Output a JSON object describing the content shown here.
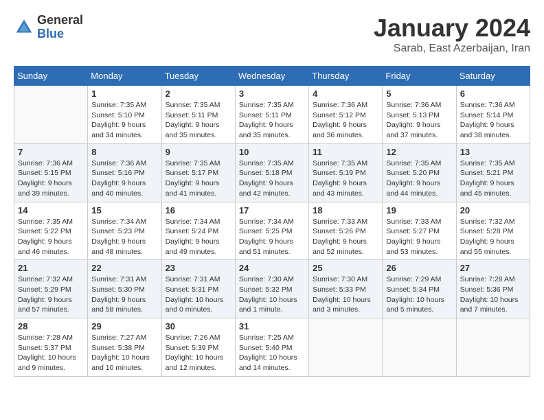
{
  "header": {
    "logo_general": "General",
    "logo_blue": "Blue",
    "month_title": "January 2024",
    "location": "Sarab, East Azerbaijan, Iran"
  },
  "columns": [
    "Sunday",
    "Monday",
    "Tuesday",
    "Wednesday",
    "Thursday",
    "Friday",
    "Saturday"
  ],
  "weeks": [
    [
      {
        "day": "",
        "sunrise": "",
        "sunset": "",
        "daylight": ""
      },
      {
        "day": "1",
        "sunrise": "Sunrise: 7:35 AM",
        "sunset": "Sunset: 5:10 PM",
        "daylight": "Daylight: 9 hours and 34 minutes."
      },
      {
        "day": "2",
        "sunrise": "Sunrise: 7:35 AM",
        "sunset": "Sunset: 5:11 PM",
        "daylight": "Daylight: 9 hours and 35 minutes."
      },
      {
        "day": "3",
        "sunrise": "Sunrise: 7:35 AM",
        "sunset": "Sunset: 5:11 PM",
        "daylight": "Daylight: 9 hours and 35 minutes."
      },
      {
        "day": "4",
        "sunrise": "Sunrise: 7:36 AM",
        "sunset": "Sunset: 5:12 PM",
        "daylight": "Daylight: 9 hours and 36 minutes."
      },
      {
        "day": "5",
        "sunrise": "Sunrise: 7:36 AM",
        "sunset": "Sunset: 5:13 PM",
        "daylight": "Daylight: 9 hours and 37 minutes."
      },
      {
        "day": "6",
        "sunrise": "Sunrise: 7:36 AM",
        "sunset": "Sunset: 5:14 PM",
        "daylight": "Daylight: 9 hours and 38 minutes."
      }
    ],
    [
      {
        "day": "7",
        "sunrise": "Sunrise: 7:36 AM",
        "sunset": "Sunset: 5:15 PM",
        "daylight": "Daylight: 9 hours and 39 minutes."
      },
      {
        "day": "8",
        "sunrise": "Sunrise: 7:36 AM",
        "sunset": "Sunset: 5:16 PM",
        "daylight": "Daylight: 9 hours and 40 minutes."
      },
      {
        "day": "9",
        "sunrise": "Sunrise: 7:35 AM",
        "sunset": "Sunset: 5:17 PM",
        "daylight": "Daylight: 9 hours and 41 minutes."
      },
      {
        "day": "10",
        "sunrise": "Sunrise: 7:35 AM",
        "sunset": "Sunset: 5:18 PM",
        "daylight": "Daylight: 9 hours and 42 minutes."
      },
      {
        "day": "11",
        "sunrise": "Sunrise: 7:35 AM",
        "sunset": "Sunset: 5:19 PM",
        "daylight": "Daylight: 9 hours and 43 minutes."
      },
      {
        "day": "12",
        "sunrise": "Sunrise: 7:35 AM",
        "sunset": "Sunset: 5:20 PM",
        "daylight": "Daylight: 9 hours and 44 minutes."
      },
      {
        "day": "13",
        "sunrise": "Sunrise: 7:35 AM",
        "sunset": "Sunset: 5:21 PM",
        "daylight": "Daylight: 9 hours and 45 minutes."
      }
    ],
    [
      {
        "day": "14",
        "sunrise": "Sunrise: 7:35 AM",
        "sunset": "Sunset: 5:22 PM",
        "daylight": "Daylight: 9 hours and 46 minutes."
      },
      {
        "day": "15",
        "sunrise": "Sunrise: 7:34 AM",
        "sunset": "Sunset: 5:23 PM",
        "daylight": "Daylight: 9 hours and 48 minutes."
      },
      {
        "day": "16",
        "sunrise": "Sunrise: 7:34 AM",
        "sunset": "Sunset: 5:24 PM",
        "daylight": "Daylight: 9 hours and 49 minutes."
      },
      {
        "day": "17",
        "sunrise": "Sunrise: 7:34 AM",
        "sunset": "Sunset: 5:25 PM",
        "daylight": "Daylight: 9 hours and 51 minutes."
      },
      {
        "day": "18",
        "sunrise": "Sunrise: 7:33 AM",
        "sunset": "Sunset: 5:26 PM",
        "daylight": "Daylight: 9 hours and 52 minutes."
      },
      {
        "day": "19",
        "sunrise": "Sunrise: 7:33 AM",
        "sunset": "Sunset: 5:27 PM",
        "daylight": "Daylight: 9 hours and 53 minutes."
      },
      {
        "day": "20",
        "sunrise": "Sunrise: 7:32 AM",
        "sunset": "Sunset: 5:28 PM",
        "daylight": "Daylight: 9 hours and 55 minutes."
      }
    ],
    [
      {
        "day": "21",
        "sunrise": "Sunrise: 7:32 AM",
        "sunset": "Sunset: 5:29 PM",
        "daylight": "Daylight: 9 hours and 57 minutes."
      },
      {
        "day": "22",
        "sunrise": "Sunrise: 7:31 AM",
        "sunset": "Sunset: 5:30 PM",
        "daylight": "Daylight: 9 hours and 58 minutes."
      },
      {
        "day": "23",
        "sunrise": "Sunrise: 7:31 AM",
        "sunset": "Sunset: 5:31 PM",
        "daylight": "Daylight: 10 hours and 0 minutes."
      },
      {
        "day": "24",
        "sunrise": "Sunrise: 7:30 AM",
        "sunset": "Sunset: 5:32 PM",
        "daylight": "Daylight: 10 hours and 1 minute."
      },
      {
        "day": "25",
        "sunrise": "Sunrise: 7:30 AM",
        "sunset": "Sunset: 5:33 PM",
        "daylight": "Daylight: 10 hours and 3 minutes."
      },
      {
        "day": "26",
        "sunrise": "Sunrise: 7:29 AM",
        "sunset": "Sunset: 5:34 PM",
        "daylight": "Daylight: 10 hours and 5 minutes."
      },
      {
        "day": "27",
        "sunrise": "Sunrise: 7:28 AM",
        "sunset": "Sunset: 5:36 PM",
        "daylight": "Daylight: 10 hours and 7 minutes."
      }
    ],
    [
      {
        "day": "28",
        "sunrise": "Sunrise: 7:28 AM",
        "sunset": "Sunset: 5:37 PM",
        "daylight": "Daylight: 10 hours and 9 minutes."
      },
      {
        "day": "29",
        "sunrise": "Sunrise: 7:27 AM",
        "sunset": "Sunset: 5:38 PM",
        "daylight": "Daylight: 10 hours and 10 minutes."
      },
      {
        "day": "30",
        "sunrise": "Sunrise: 7:26 AM",
        "sunset": "Sunset: 5:39 PM",
        "daylight": "Daylight: 10 hours and 12 minutes."
      },
      {
        "day": "31",
        "sunrise": "Sunrise: 7:25 AM",
        "sunset": "Sunset: 5:40 PM",
        "daylight": "Daylight: 10 hours and 14 minutes."
      },
      {
        "day": "",
        "sunrise": "",
        "sunset": "",
        "daylight": ""
      },
      {
        "day": "",
        "sunrise": "",
        "sunset": "",
        "daylight": ""
      },
      {
        "day": "",
        "sunrise": "",
        "sunset": "",
        "daylight": ""
      }
    ]
  ]
}
